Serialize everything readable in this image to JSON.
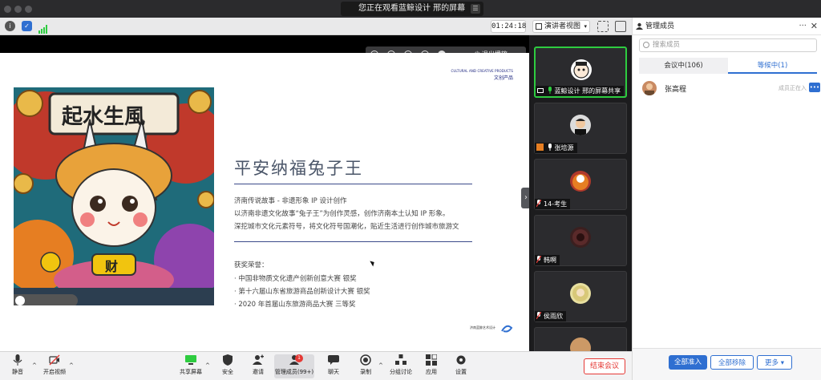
{
  "window": {
    "banner": "您正在观看蓝鲸设计 邢的屏幕",
    "timer": "01:24:18",
    "view_mode": "演讲者视图"
  },
  "share_controls": {
    "stop_label": "退出播放"
  },
  "slide": {
    "header_en": "CULTURAL AND CREATIVE PRODUCTS",
    "header_cn": "文创产品",
    "title": "平安纳福兔子王",
    "desc_lines": [
      "济南传说故事 - 非遗形象 IP 设计创作",
      "以济南非遗文化故事“兔子王”为创作灵感，创作济南本土认知 IP 形象。",
      "深挖城市文化元素符号，将文化符号国潮化，贴近生活进行创作城市旅游文"
    ],
    "awards_title": "获奖荣誉：",
    "awards": [
      "· 中国非物质文化遗产创新创意大赛 银奖",
      "· 第十六届山东省旅游商品创新设计大赛 银奖",
      "· 2020 年首届山东旅游商品大赛 三等奖"
    ],
    "artwork_text_top": "起水生風",
    "artwork_text_mid": "财",
    "footer_logo": "济南蓝鲸艺术设计"
  },
  "videos": [
    {
      "name": "蓝鲸设计 邢的屏幕共享",
      "active": true
    },
    {
      "name": "张培源"
    },
    {
      "name": "14-考生"
    },
    {
      "name": "韩啊"
    },
    {
      "name": "侯雨欣"
    },
    {
      "name": ""
    }
  ],
  "panel": {
    "title": "管理成员",
    "search_placeholder": "搜索成员",
    "tab_in_meeting": "会议中(106)",
    "tab_waiting": "等候中(1)",
    "member_name": "张高程",
    "member_status": "成员正在入",
    "member_more": "•••",
    "btn_admit_all": "全部准入",
    "btn_remove_all": "全部移除",
    "btn_more": "更多 ▾"
  },
  "controls": {
    "mute": "静音",
    "video": "开启视频",
    "share": "共享屏幕",
    "security": "安全",
    "invite": "邀请",
    "members": "管理成员(99+)",
    "members_badge": "1",
    "chat": "聊天",
    "record": "录制",
    "breakout": "分组讨论",
    "apps": "应用",
    "settings": "设置",
    "end": "结束会议"
  }
}
